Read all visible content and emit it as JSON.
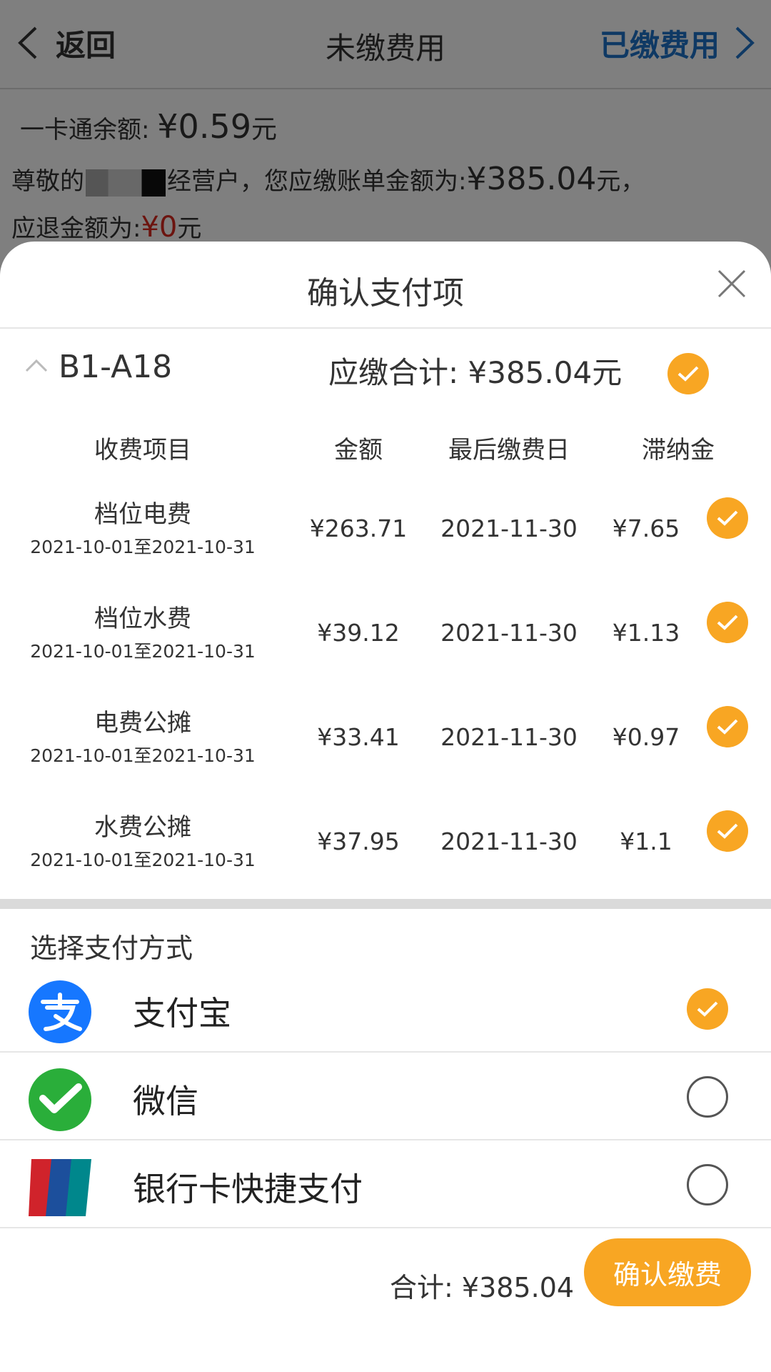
{
  "navbar": {
    "back_label": "返回",
    "title": "未缴费用",
    "right_label": "已缴费用"
  },
  "background": {
    "balance_label": "一卡通余额:",
    "balance_amount": "¥0.59",
    "balance_unit": "元",
    "bill_prefix": "尊敬的",
    "bill_suffix": "经营户，您应缴账单金额为:",
    "bill_amount": "¥385.04",
    "bill_unit": "元，",
    "refund_label": "应退金额为:",
    "refund_amount": "¥0",
    "refund_unit": "元"
  },
  "sheet": {
    "title": "确认支付项",
    "unit": {
      "name": "B1-A18",
      "total_label": "应缴合计:",
      "total_amount": "¥385.04元"
    },
    "columns": {
      "item": "收费项目",
      "amount": "金额",
      "due": "最后缴费日",
      "late": "滞纳金"
    },
    "fees": [
      {
        "name": "档位电费",
        "period": "2021-10-01至2021-10-31",
        "amount": "¥263.71",
        "due": "2021-11-30",
        "late": "¥7.65"
      },
      {
        "name": "档位水费",
        "period": "2021-10-01至2021-10-31",
        "amount": "¥39.12",
        "due": "2021-11-30",
        "late": "¥1.13"
      },
      {
        "name": "电费公摊",
        "period": "2021-10-01至2021-10-31",
        "amount": "¥33.41",
        "due": "2021-11-30",
        "late": "¥0.97"
      },
      {
        "name": "水费公摊",
        "period": "2021-10-01至2021-10-31",
        "amount": "¥37.95",
        "due": "2021-11-30",
        "late": "¥1.1"
      }
    ],
    "payment": {
      "title": "选择支付方式",
      "methods": [
        {
          "label": "支付宝",
          "selected": true
        },
        {
          "label": "微信",
          "selected": false
        },
        {
          "label": "银行卡快捷支付",
          "selected": false
        }
      ]
    },
    "footer": {
      "total_label": "合计:",
      "total_amount": "¥385.04",
      "confirm_label": "确认缴费"
    }
  },
  "colors": {
    "accent": "#f8a623",
    "link_blue": "#1e73c8",
    "refund_red": "#d9281e",
    "alipay_blue": "#1677ff",
    "wechat_green": "#2aae3a"
  }
}
